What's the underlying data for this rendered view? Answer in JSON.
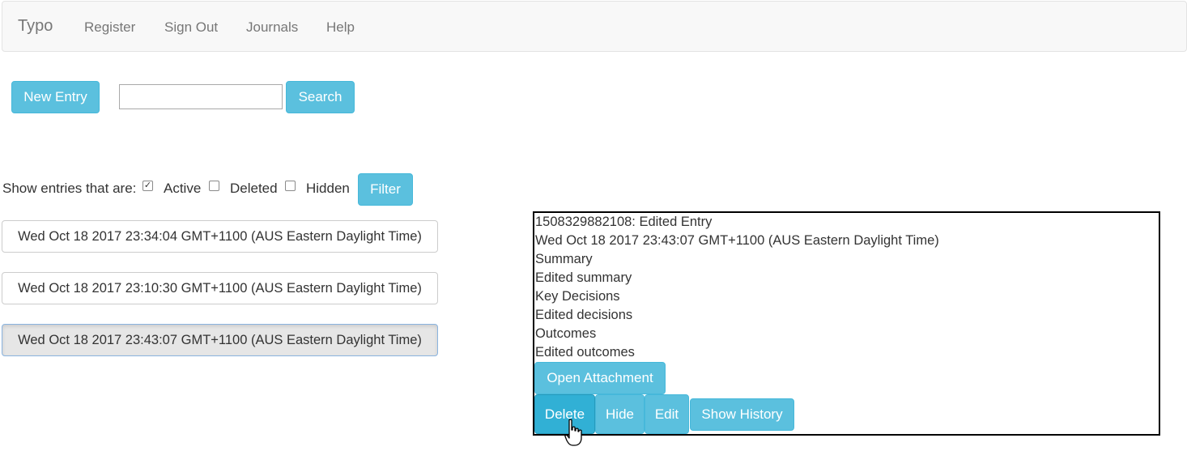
{
  "navbar": {
    "brand": "Typo",
    "links": [
      "Register",
      "Sign Out",
      "Journals",
      "Help"
    ]
  },
  "toolbar": {
    "new_entry_label": "New Entry",
    "search_value": "",
    "search_label": "Search"
  },
  "filter": {
    "prompt": "Show entries that are:",
    "options": [
      {
        "label": "Active",
        "checked": true
      },
      {
        "label": "Deleted",
        "checked": false
      },
      {
        "label": "Hidden",
        "checked": false
      }
    ],
    "filter_label": "Filter"
  },
  "entries": [
    "Wed Oct 18 2017 23:34:04 GMT+1100 (AUS Eastern Daylight Time)",
    "Wed Oct 18 2017 23:10:30 GMT+1100 (AUS Eastern Daylight Time)",
    "Wed Oct 18 2017 23:43:07 GMT+1100 (AUS Eastern Daylight Time)"
  ],
  "detail": {
    "lines": [
      "1508329882108: Edited Entry",
      "Wed Oct 18 2017 23:43:07 GMT+1100 (AUS Eastern Daylight Time)",
      "Summary",
      "Edited summary",
      "Key Decisions",
      "Edited decisions",
      "Outcomes",
      "Edited outcomes"
    ],
    "open_attachment_label": "Open Attachment",
    "delete_label": "Delete",
    "hide_label": "Hide",
    "edit_label": "Edit",
    "show_history_label": "Show History"
  },
  "colors": {
    "button_info": "#5bc0de",
    "button_info_active": "#31b0d5",
    "navbar_bg": "#f8f8f8"
  }
}
